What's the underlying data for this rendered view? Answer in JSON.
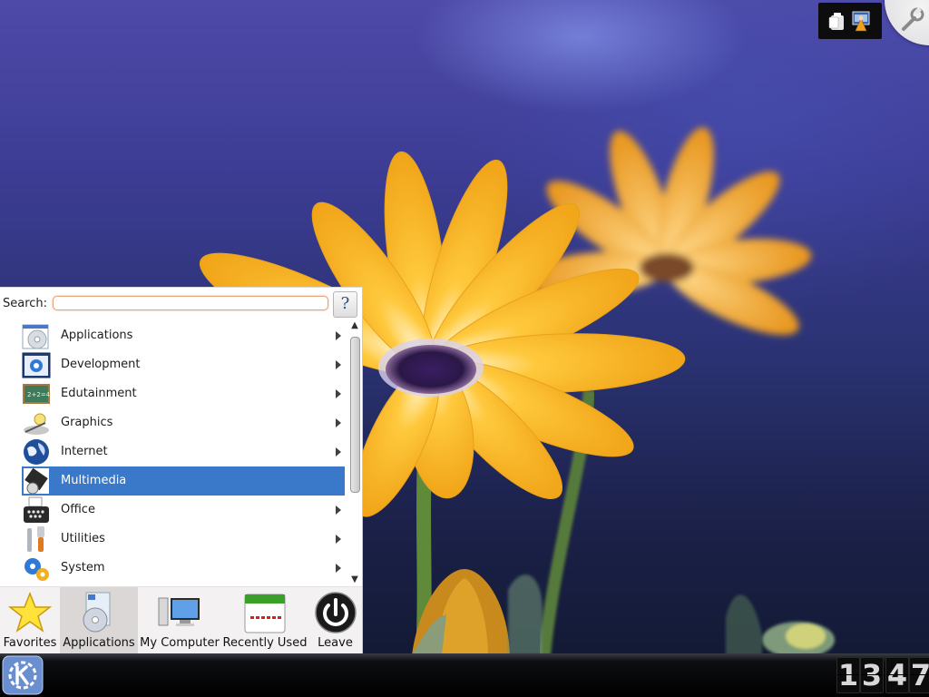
{
  "launcher": {
    "search_label": "Search:",
    "search_value": "",
    "help_label": "?",
    "menu_items": [
      {
        "label": "Applications",
        "icon": "cd-applications-icon",
        "submenu": true
      },
      {
        "label": "Development",
        "icon": "development-gear-icon",
        "submenu": true
      },
      {
        "label": "Edutainment",
        "icon": "chalkboard-icon",
        "submenu": true
      },
      {
        "label": "Graphics",
        "icon": "graphics-icon",
        "submenu": true
      },
      {
        "label": "Internet",
        "icon": "globe-icon",
        "submenu": true
      },
      {
        "label": "Multimedia",
        "icon": "multimedia-icon",
        "submenu": false,
        "selected": true
      },
      {
        "label": "Office",
        "icon": "typewriter-icon",
        "submenu": true
      },
      {
        "label": "Utilities",
        "icon": "tools-icon",
        "submenu": true
      },
      {
        "label": "System",
        "icon": "system-gears-icon",
        "submenu": true
      }
    ],
    "tabs": [
      {
        "label": "Favorites",
        "icon": "star-icon"
      },
      {
        "label": "Applications",
        "icon": "applications-icon",
        "active": true
      },
      {
        "label": "My Computer",
        "icon": "computer-icon"
      },
      {
        "label": "Recently Used",
        "icon": "calendar-icon"
      },
      {
        "label": "Leave",
        "icon": "power-icon"
      }
    ]
  },
  "panel": {
    "start_button_icon": "kde-logo-icon",
    "clock": {
      "hours": "13",
      "minutes": "47",
      "digits": [
        "1",
        "3",
        "4",
        "7"
      ]
    }
  },
  "tray": {
    "icons": [
      "clipboard-icon",
      "network-manager-icon"
    ],
    "toolbox_icon": "wrench-icon"
  },
  "colors": {
    "selection": "#3a78c9",
    "search_focus": "#e8a37a",
    "panel": "#000000"
  }
}
